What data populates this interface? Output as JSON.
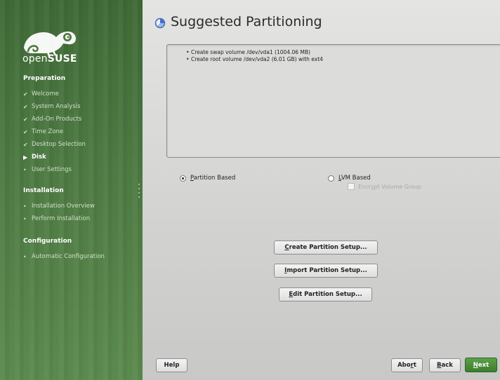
{
  "sidebar": {
    "logo_text_light": "open",
    "logo_text_bold": "SUSE",
    "sections": [
      {
        "title": "Preparation",
        "steps": [
          {
            "label": "Welcome",
            "state": "done"
          },
          {
            "label": "System Analysis",
            "state": "done"
          },
          {
            "label": "Add-On Products",
            "state": "done"
          },
          {
            "label": "Time Zone",
            "state": "done"
          },
          {
            "label": "Desktop Selection",
            "state": "done"
          },
          {
            "label": "Disk",
            "state": "current"
          },
          {
            "label": "User Settings",
            "state": "pending"
          }
        ]
      },
      {
        "title": "Installation",
        "steps": [
          {
            "label": "Installation Overview",
            "state": "pending"
          },
          {
            "label": "Perform Installation",
            "state": "pending"
          }
        ]
      },
      {
        "title": "Configuration",
        "steps": [
          {
            "label": "Automatic Configuration",
            "state": "pending"
          }
        ]
      }
    ],
    "marks": {
      "done": "✔",
      "current": "▶",
      "pending": "•"
    }
  },
  "main": {
    "title": "Suggested Partitioning",
    "proposal": [
      "Create swap volume /dev/vda1 (1004.06 MB)",
      "Create root volume /dev/vda2 (6.01 GB) with ext4"
    ],
    "partition_based": {
      "label_key": "P",
      "label_rest": "artition Based",
      "selected": true
    },
    "lvm_based": {
      "label_key": "L",
      "label_rest": "VM Based",
      "selected": false
    },
    "encrypt": {
      "label_pre": "Encr",
      "label_key": "y",
      "label_rest": "pt Volume Group",
      "checked": false,
      "enabled": false
    },
    "buttons": {
      "create": {
        "key": "C",
        "rest": "reate Partition Setup..."
      },
      "import": {
        "key": "I",
        "rest": "mport Partition Setup..."
      },
      "edit": {
        "key": "E",
        "rest": "dit Partition Setup..."
      }
    }
  },
  "footer": {
    "help": "Help",
    "abort": {
      "pre": "Abo",
      "key": "r",
      "rest": "t"
    },
    "back": {
      "key": "B",
      "rest": "ack"
    },
    "next": {
      "key": "N",
      "rest": "ext"
    }
  },
  "colors": {
    "sidebar": "#4e7a43",
    "accent_button": "#3d7d2e"
  }
}
